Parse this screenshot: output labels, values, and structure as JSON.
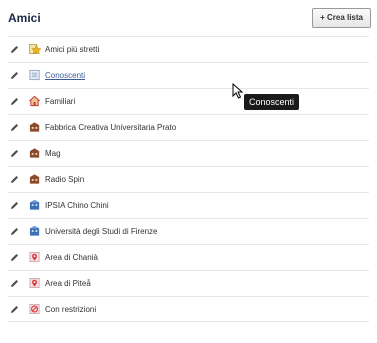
{
  "header": {
    "title": "Amici",
    "create_button": "+ Crea lista"
  },
  "lists": [
    {
      "label": "Amici più stretti",
      "icon": "star-icon",
      "color": "#f2b01e",
      "link": false
    },
    {
      "label": "Conoscenti",
      "icon": "list-icon",
      "color": "#8fa3c7",
      "link": true
    },
    {
      "label": "Familiari",
      "icon": "home-icon",
      "color": "#c0392b",
      "link": false
    },
    {
      "label": "Fabbrica Creativa Universitaria Prato",
      "icon": "building-icon",
      "color": "#8b4a2b",
      "link": false
    },
    {
      "label": "Mag",
      "icon": "building-icon",
      "color": "#8b4a2b",
      "link": false
    },
    {
      "label": "Radio Spin",
      "icon": "building-icon",
      "color": "#8b4a2b",
      "link": false
    },
    {
      "label": "IPSIA Chino Chini",
      "icon": "school-icon",
      "color": "#3d6fb5",
      "link": false
    },
    {
      "label": "Università degli Studi di Firenze",
      "icon": "school-icon",
      "color": "#3d6fb5",
      "link": false
    },
    {
      "label": "Area di Chanià",
      "icon": "location-icon",
      "color": "#d93a3a",
      "link": false
    },
    {
      "label": "Area di Piteå",
      "icon": "location-icon",
      "color": "#d93a3a",
      "link": false
    },
    {
      "label": "Con restrizioni",
      "icon": "restricted-icon",
      "color": "#d93a3a",
      "link": false
    }
  ],
  "tooltip": {
    "text": "Conoscenti"
  }
}
